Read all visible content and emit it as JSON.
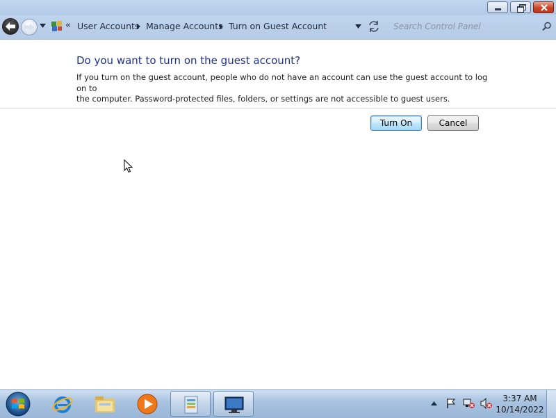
{
  "window": {
    "minimize_icon": "minimize-icon",
    "restore_icon": "restore-icon",
    "close_icon": "close-icon"
  },
  "navigation": {
    "back_icon": "back-arrow-icon",
    "forward_icon": "forward-arrow-icon",
    "address_icon": "control-panel-icon",
    "overflow_chevron": "«",
    "breadcrumbs": [
      "User Accounts",
      "Manage Accounts",
      "Turn on Guest Account"
    ],
    "search_placeholder": "Search Control Panel"
  },
  "content": {
    "heading": "Do you want to turn on the guest account?",
    "description_line1": "If you turn on the guest account, people who do not have an account can use the guest account to log on to",
    "description_line2": "the computer. Password-protected files, folders, or settings are not accessible to guest users.",
    "turn_on_label": "Turn On",
    "cancel_label": "Cancel"
  },
  "taskbar": {
    "items": [
      "start-orb-icon",
      "internet-explorer-icon",
      "file-explorer-icon",
      "media-player-icon",
      "control-panel-icon",
      "remote-desktop-icon"
    ],
    "time": "3:37 AM",
    "date": "10/14/2022"
  },
  "colors": {
    "heading": "#1e3287",
    "chrome": "#bfd4ee",
    "taskbar": "#a9c3e0"
  }
}
